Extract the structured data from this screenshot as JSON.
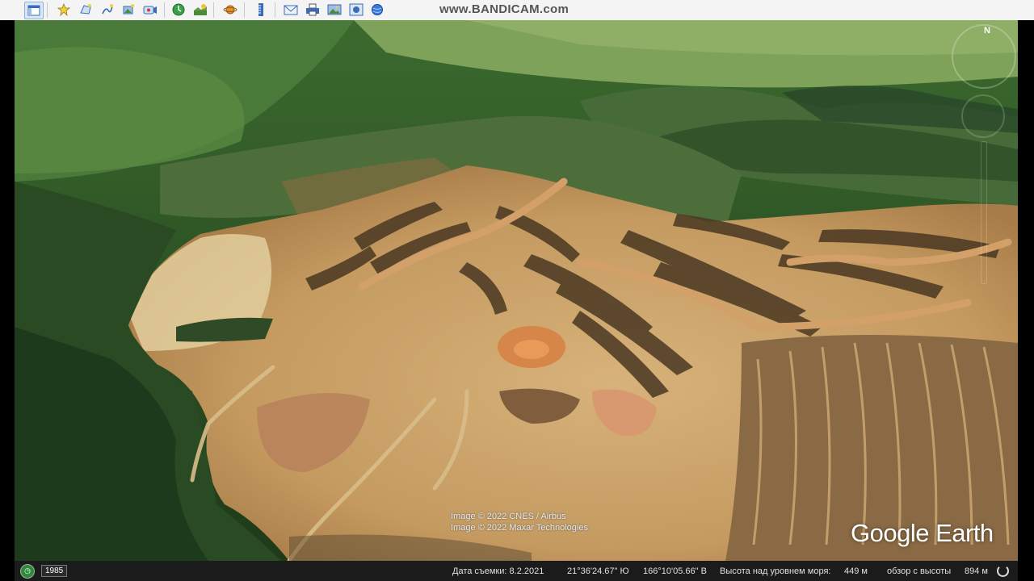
{
  "toolbar": {
    "buttons": [
      {
        "icon": "sidebar-toggle-icon"
      },
      {
        "icon": "add-placemark-icon"
      },
      {
        "icon": "add-polygon-icon"
      },
      {
        "icon": "add-path-icon"
      },
      {
        "icon": "add-image-overlay-icon"
      },
      {
        "icon": "record-tour-icon"
      },
      {
        "icon": "historical-imagery-icon"
      },
      {
        "icon": "sunlight-icon"
      },
      {
        "icon": "planets-icon"
      },
      {
        "icon": "ruler-icon"
      },
      {
        "icon": "email-icon"
      },
      {
        "icon": "print-icon"
      },
      {
        "icon": "save-image-icon"
      },
      {
        "icon": "view-in-maps-icon"
      }
    ],
    "watermark": "www.BANDICAM.com"
  },
  "viewport": {
    "attribution_line1": "Image © 2022 CNES / Airbus",
    "attribution_line2": "Image © 2022 Maxar Technologies",
    "brand": "Google Earth",
    "compass_letter": "N"
  },
  "status": {
    "year": "1985",
    "imagery_date_label": "Дата съемки: 8.2.2021",
    "latitude": "21°36'24.67\" Ю",
    "longitude": "166°10'05.66\" В",
    "elevation_label": "Высота над уровнем моря:",
    "elevation_value": "449 м",
    "eye_alt_label": "обзор с высоты",
    "eye_alt_value": "894 м"
  },
  "colors": {
    "forest": "#2f5a2a",
    "grass": "#7fa25a",
    "mine_soil": "#c9a46a",
    "red_earth": "#b8703f",
    "statusbar": "#1b1b1b"
  }
}
